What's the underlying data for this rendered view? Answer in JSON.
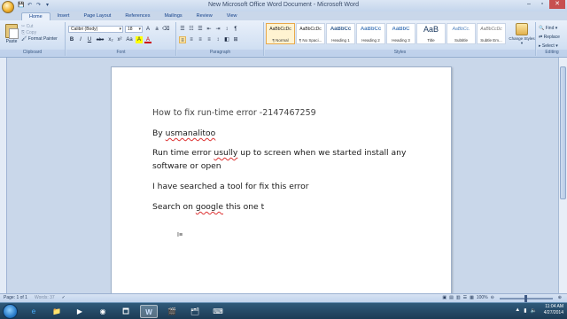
{
  "window": {
    "title": "New Microsoft Office Word Document - Microsoft Word",
    "qat": [
      "💾",
      "↶",
      "↷",
      "▾"
    ],
    "controls": [
      "–",
      "▫",
      "✕"
    ]
  },
  "tabs": [
    "Home",
    "Insert",
    "Page Layout",
    "References",
    "Mailings",
    "Review",
    "View"
  ],
  "ribbon": {
    "clipboard": {
      "paste_label": "Paste",
      "cut_label": "Cut",
      "copy_label": "Copy",
      "format_painter_label": "Format Painter",
      "group_label": "Clipboard"
    },
    "font": {
      "font_name": "Calibri (Body)",
      "font_size": "18",
      "group_label": "Font",
      "buttons": [
        "B",
        "I",
        "U",
        "abe",
        "x₂",
        "x²",
        "Aa",
        "A",
        "A"
      ]
    },
    "paragraph": {
      "group_label": "Paragraph",
      "buttons": [
        "☰",
        "☷",
        "☰",
        "⇤",
        "⇥",
        "↕",
        "¶",
        "≡",
        "≡",
        "≡",
        "≡",
        "↕",
        "◧",
        "⊞"
      ]
    },
    "styles": {
      "group_label": "Styles",
      "items": [
        {
          "sample": "AaBbCcDc",
          "name": "¶ Normal"
        },
        {
          "sample": "AaBbCcDc",
          "name": "¶ No Spaci..."
        },
        {
          "sample": "AaBbCc",
          "name": "Heading 1"
        },
        {
          "sample": "AaBbCc",
          "name": "Heading 2"
        },
        {
          "sample": "AaBbC",
          "name": "Heading 3"
        },
        {
          "sample": "AaB",
          "name": "Title"
        },
        {
          "sample": "AaBbCc.",
          "name": "Subtitle"
        },
        {
          "sample": "AaBbCcDc",
          "name": "Subtle Em..."
        }
      ],
      "change_styles_label": "Change Styles ▾"
    },
    "editing": {
      "group_label": "Editing",
      "find_label": "Find ▾",
      "replace_label": "Replace",
      "select_label": "Select ▾"
    }
  },
  "document": {
    "lines": [
      "How to fix run-time error  -2147467259",
      "By usmanalitoo",
      "Run time error usully up to screen when we started install any",
      "software or open",
      "I have searched a tool for fix this error",
      "Search on google this one t"
    ]
  },
  "status": {
    "page": "Page: 1 of 1",
    "words": "Words: 37",
    "zoom": "100%"
  },
  "taskbar": {
    "icons": [
      "e",
      "📁",
      "▶",
      "◉",
      "🗖",
      "W",
      "🎬",
      "🗂",
      "⌨"
    ],
    "time": "11:04 AM",
    "date": "4/27/2014"
  }
}
